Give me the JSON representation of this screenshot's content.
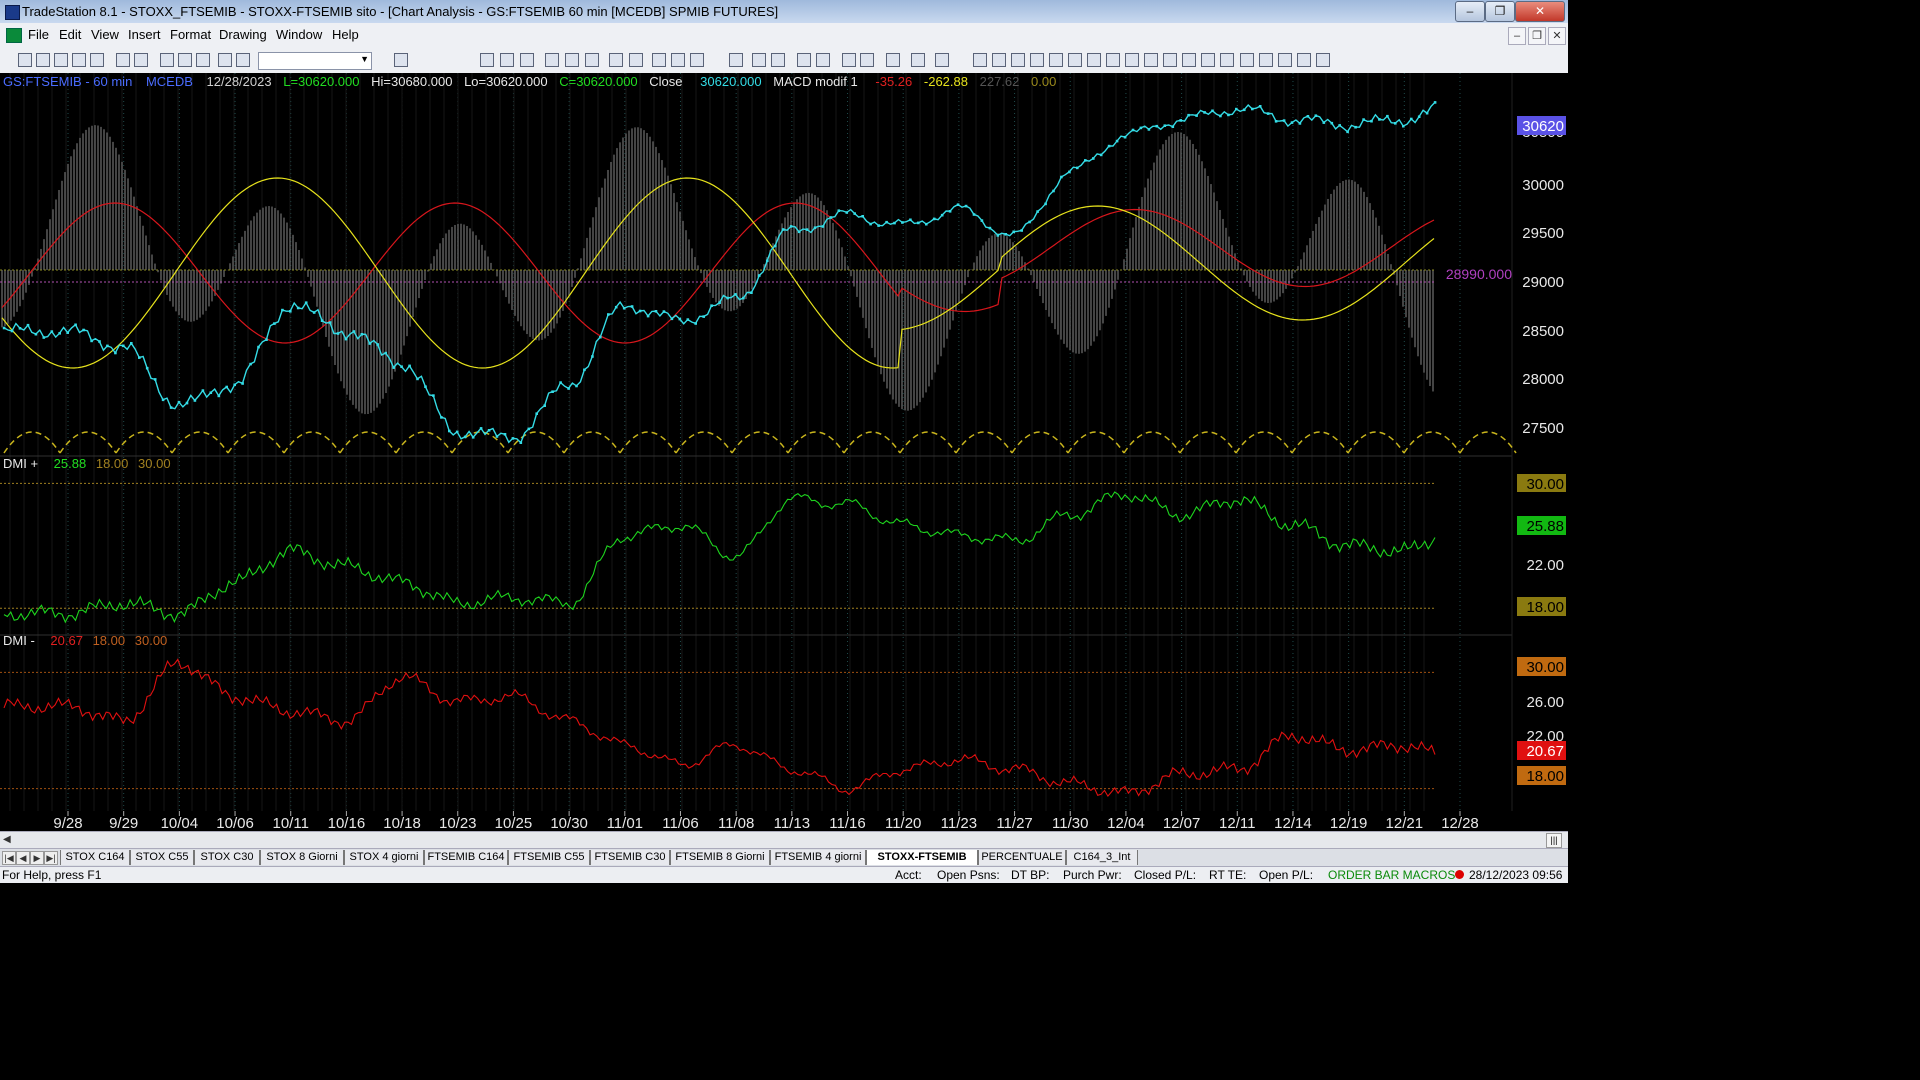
{
  "window": {
    "title": "TradeStation 8.1 - STOXX_FTSEMIB - STOXX-FTSEMIB sito - [Chart Analysis - GS:FTSEMIB  60 min  [MCEDB] SPMIB FUTURES]",
    "buttons": {
      "minimize": "–",
      "restore": "❐",
      "close": "✕"
    }
  },
  "menu": {
    "items": [
      "File",
      "Edit",
      "View",
      "Insert",
      "Format",
      "Drawing",
      "Window",
      "Help"
    ],
    "mdi_buttons": [
      "–",
      "❐",
      "✕"
    ]
  },
  "toolbar": {
    "combo_value": ""
  },
  "chart": {
    "price_header": {
      "symbol": "GS:FTSEMIB - 60 min",
      "tag": "MCEDB",
      "date": "12/28/2023",
      "low_label": "L=30620.000",
      "high_label": "Hi=30680.000",
      "low2_label": "Lo=30620.000",
      "close_label": "C=30620.000",
      "close_word": "Close",
      "close_value": "30620.000",
      "indicator": "MACD modif 1",
      "ind_v1": "-35.26",
      "ind_v2": "-262.88",
      "ind_v3": "227.62",
      "ind_v4": "0.00"
    },
    "price_axis_labels": [
      "30500",
      "30000",
      "29500",
      "29000",
      "28500",
      "28000",
      "27500"
    ],
    "price_tag_last": "30620",
    "price_tag_level": "28990.000",
    "dmi_plus": {
      "header": "DMI +",
      "values": [
        "25.88",
        "18.00",
        "30.00"
      ],
      "axis_labels": [
        "30.00",
        "22.00",
        "18.00"
      ],
      "tag_value": "25.88"
    },
    "dmi_minus": {
      "header": "DMI -",
      "values": [
        "20.67",
        "18.00",
        "30.00"
      ],
      "axis_labels": [
        "30.00",
        "26.00",
        "22.00",
        "18.00"
      ],
      "tag_value": "20.67"
    },
    "date_labels": [
      "9/28",
      "9/29",
      "10/04",
      "10/06",
      "10/11",
      "10/16",
      "10/18",
      "10/23",
      "10/25",
      "10/30",
      "11/01",
      "11/06",
      "11/08",
      "11/13",
      "11/16",
      "11/20",
      "11/23",
      "11/27",
      "11/30",
      "12/04",
      "12/07",
      "12/11",
      "12/14",
      "12/19",
      "12/21",
      "12/28"
    ],
    "colors": {
      "price": "#34dce6",
      "macd_red": "#d8161c",
      "macd_yellow": "#e6e21c",
      "dmi_plus": "#1ed41e",
      "dmi_minus": "#e01010",
      "hist": "#5a5a5a",
      "level_line": "#c060c0"
    }
  },
  "chart_data": [
    {
      "type": "line",
      "title": "GS:FTSEMIB - 60 min",
      "x": [
        "9/28",
        "9/29",
        "10/04",
        "10/06",
        "10/11",
        "10/16",
        "10/18",
        "10/23",
        "10/25",
        "10/30",
        "11/01",
        "11/06",
        "11/08",
        "11/13",
        "11/16",
        "11/20",
        "11/23",
        "11/27",
        "11/30",
        "12/04",
        "12/07",
        "12/11",
        "12/14",
        "12/19",
        "12/21",
        "12/28"
      ],
      "series": [
        {
          "name": "Close",
          "values": [
            28450,
            28300,
            27750,
            27950,
            28700,
            28450,
            28150,
            27500,
            27450,
            27950,
            28700,
            28550,
            28750,
            29400,
            29550,
            29450,
            29600,
            29350,
            29950,
            30300,
            30450,
            30550,
            30450,
            30400,
            30450,
            30620
          ]
        }
      ],
      "ylim": [
        27300,
        30700
      ]
    },
    {
      "type": "line",
      "title": "DMI +",
      "x": [
        "9/28",
        "9/29",
        "10/04",
        "10/06",
        "10/11",
        "10/16",
        "10/18",
        "10/23",
        "10/25",
        "10/30",
        "11/01",
        "11/06",
        "11/08",
        "11/13",
        "11/16",
        "11/20",
        "11/23",
        "11/27",
        "11/30",
        "12/04",
        "12/07",
        "12/11",
        "12/14",
        "12/19",
        "12/21",
        "12/28"
      ],
      "series": [
        {
          "values": [
            17.5,
            18.5,
            17.5,
            20.5,
            23.5,
            22,
            20.5,
            18.5,
            19,
            18.5,
            25,
            26,
            23,
            28.5,
            28,
            26,
            25,
            24.5,
            27,
            29,
            27,
            28.5,
            26,
            24,
            23.5,
            25.88
          ]
        }
      ],
      "ylim": [
        16,
        31
      ]
    },
    {
      "type": "line",
      "title": "DMI -",
      "x": [
        "9/28",
        "9/29",
        "10/04",
        "10/06",
        "10/11",
        "10/16",
        "10/18",
        "10/23",
        "10/25",
        "10/30",
        "11/01",
        "11/06",
        "11/08",
        "11/13",
        "11/16",
        "11/20",
        "11/23",
        "11/27",
        "11/30",
        "12/04",
        "12/07",
        "12/11",
        "12/14",
        "12/19",
        "12/21",
        "12/28"
      ],
      "series": [
        {
          "values": [
            26.5,
            25,
            31,
            27.5,
            26,
            25,
            29.5,
            27,
            27.5,
            25,
            22.5,
            20.5,
            22.5,
            20,
            18,
            20,
            21,
            20,
            18.5,
            17.5,
            19.5,
            20,
            23.5,
            22,
            22.5,
            20.67
          ]
        }
      ],
      "ylim": [
        16,
        32
      ]
    }
  ],
  "tabs": [
    "STOX C164",
    "STOX C55",
    "STOX  C30",
    "STOX  8 Giorni",
    "STOX 4 giorni",
    "FTSEMIB C164",
    "FTSEMIB C55",
    "FTSEMIB C30",
    "FTSEMIB  8 Giorni",
    "FTSEMIB  4 giorni",
    "STOXX-FTSEMIB sito",
    "PERCENTUALE",
    "C164_3_Int"
  ],
  "status": {
    "help": "For Help, press F1",
    "acct": "Acct:",
    "open_psns": "Open Psns:",
    "dt_bp": "DT BP:",
    "purch_pwr": "Purch Pwr:",
    "closed_pl": "Closed P/L:",
    "rt_te": "RT TE:",
    "open_pl": "Open P/L:",
    "order_bar": "ORDER BAR  MACROS",
    "datetime": "28/12/2023 09:56"
  }
}
